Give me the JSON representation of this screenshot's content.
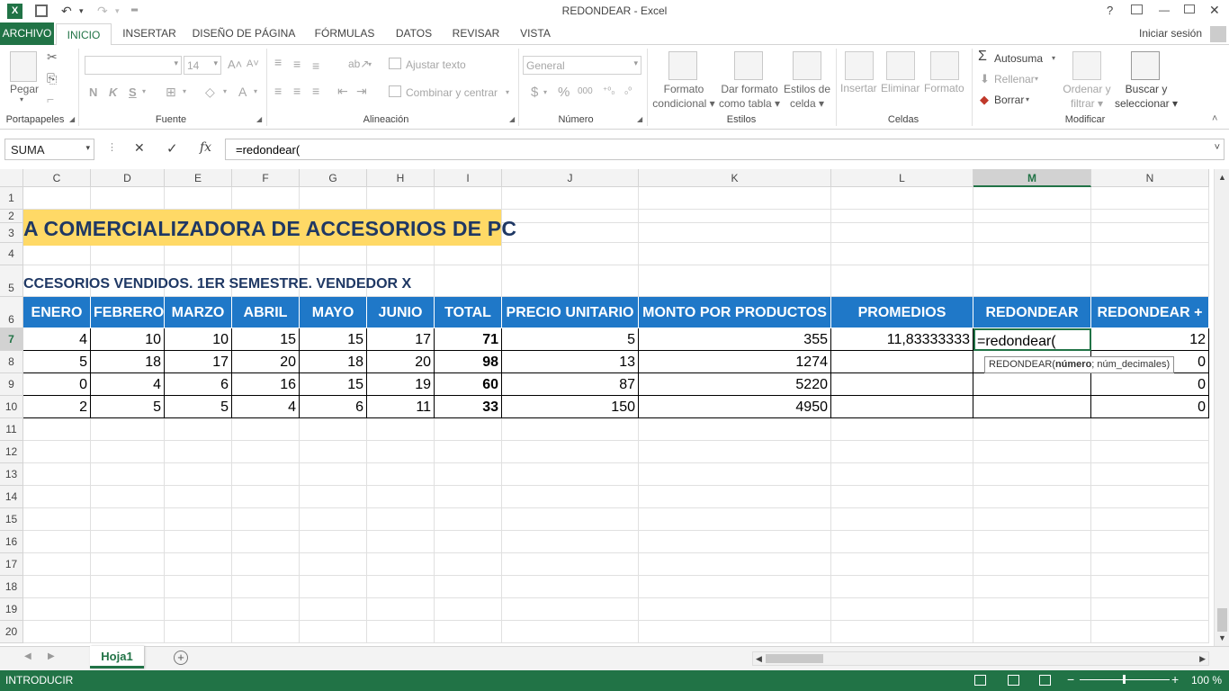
{
  "window": {
    "title": "REDONDEAR - Excel",
    "controls": [
      "?",
      "❐",
      "—",
      "❐",
      "✕"
    ]
  },
  "ribbon_tabs": {
    "archivo": "ARCHIVO",
    "items": [
      "INICIO",
      "INSERTAR",
      "DISEÑO DE PÁGINA",
      "FÓRMULAS",
      "DATOS",
      "REVISAR",
      "VISTA"
    ],
    "signin": "Iniciar sesión"
  },
  "ribbon": {
    "portapapeles": {
      "label": "Portapapeles",
      "pegar": "Pegar"
    },
    "fuente": {
      "label": "Fuente",
      "font_size": "14",
      "bold": "N",
      "italic": "K",
      "underline": "S",
      "font_color": "A"
    },
    "alineacion": {
      "label": "Alineación",
      "wrap": "Ajustar texto",
      "merge": "Combinar y centrar"
    },
    "numero": {
      "label": "Número",
      "format": "General",
      "currency": "$",
      "percent": "%",
      "thousands": "000",
      "inc_dec": "⁺⁰₀",
      "dec_dec": "₀⁰"
    },
    "estilos": {
      "label": "Estilos",
      "formato_condicional": [
        "Formato",
        "condicional"
      ],
      "formato_tabla": [
        "Dar formato",
        "como tabla"
      ],
      "estilos_celda": [
        "Estilos de",
        "celda"
      ]
    },
    "celdas": {
      "label": "Celdas",
      "insertar": "Insertar",
      "eliminar": "Eliminar",
      "formato": "Formato"
    },
    "modificar": {
      "label": "Modificar",
      "autosuma": "Autosuma",
      "rellenar": "Rellenar",
      "borrar": "Borrar",
      "ordenar": [
        "Ordenar y",
        "filtrar"
      ],
      "buscar": [
        "Buscar y",
        "seleccionar"
      ]
    }
  },
  "formula_bar": {
    "name_box": "SUMA",
    "cancel": "✕",
    "enter": "✓",
    "fx": "fx",
    "content": "=redondear("
  },
  "columns": [
    "C",
    "D",
    "E",
    "F",
    "G",
    "H",
    "I",
    "J",
    "K",
    "L",
    "M",
    "N"
  ],
  "rows": [
    "1",
    "2",
    "3",
    "4",
    "5",
    "6",
    "7",
    "8",
    "9",
    "10",
    "11",
    "12",
    "13",
    "14",
    "15",
    "16",
    "17",
    "18",
    "19",
    "20"
  ],
  "sheet": {
    "title": "A COMERCIALIZADORA DE ACCESORIOS DE PC",
    "subtitle": "CCESORIOS VENDIDOS. 1ER SEMESTRE. VENDEDOR X",
    "headers": [
      "ENERO",
      "FEBRERO",
      "MARZO",
      "ABRIL",
      "MAYO",
      "JUNIO",
      "TOTAL",
      "PRECIO UNITARIO",
      "MONTO POR PRODUCTOS",
      "PROMEDIOS",
      "REDONDEAR",
      "REDONDEAR +"
    ],
    "data": [
      [
        "4",
        "10",
        "10",
        "15",
        "15",
        "17",
        "71",
        "5",
        "355",
        "11,83333333",
        "=redondear(",
        "12"
      ],
      [
        "5",
        "18",
        "17",
        "20",
        "18",
        "20",
        "98",
        "13",
        "1274",
        "",
        "",
        "0"
      ],
      [
        "0",
        "4",
        "6",
        "16",
        "15",
        "19",
        "60",
        "87",
        "5220",
        "",
        "",
        "0"
      ],
      [
        "2",
        "5",
        "5",
        "4",
        "6",
        "11",
        "33",
        "150",
        "4950",
        "",
        "",
        "0"
      ]
    ],
    "tooltip": {
      "func": "REDONDEAR(",
      "arg1": "número",
      "rest": "; núm_decimales)"
    }
  },
  "sheet_tabs": {
    "active": "Hoja1"
  },
  "status": {
    "mode": "INTRODUCIR",
    "zoom": "100 %"
  },
  "colors": {
    "excel_green": "#217346",
    "header_blue": "#1f78c8",
    "title_yellow": "#ffd966",
    "title_text": "#1f3864"
  }
}
